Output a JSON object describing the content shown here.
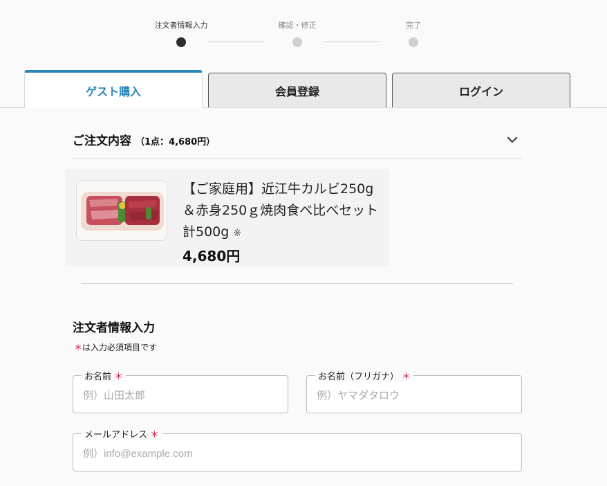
{
  "stepper": {
    "steps": [
      {
        "label": "注文者情報入力",
        "active": true
      },
      {
        "label": "確認・修正",
        "active": false
      },
      {
        "label": "完了",
        "active": false
      }
    ]
  },
  "tabs": [
    {
      "label": "ゲスト購入",
      "active": true
    },
    {
      "label": "会員登録",
      "active": false
    },
    {
      "label": "ログイン",
      "active": false
    }
  ],
  "order_summary": {
    "title": "ご注文内容",
    "count_text": "（1点：4,680円）",
    "product": {
      "name": "【ご家庭用】近江牛カルビ250g＆赤身250ｇ焼肉食べ比べセット計500g",
      "mark": "※",
      "price": "4,680円"
    }
  },
  "form": {
    "section_title": "注文者情報入力",
    "required_mark": "＊",
    "required_note": "は入力必須項目です",
    "fields": {
      "name": {
        "label": "お名前",
        "placeholder": "例）山田太郎"
      },
      "name_kana": {
        "label": "お名前（フリガナ）",
        "placeholder": "例）ヤマダタロウ"
      },
      "email": {
        "label": "メールアドレス",
        "placeholder": "例）info@example.com"
      }
    }
  },
  "colors": {
    "accent": "#2a86b9",
    "required": "#d0103a",
    "step_active": "#2d2d2d",
    "step_inactive": "#cfcfcf"
  },
  "icons": {
    "collapse_toggle": "chevron-down-icon"
  }
}
